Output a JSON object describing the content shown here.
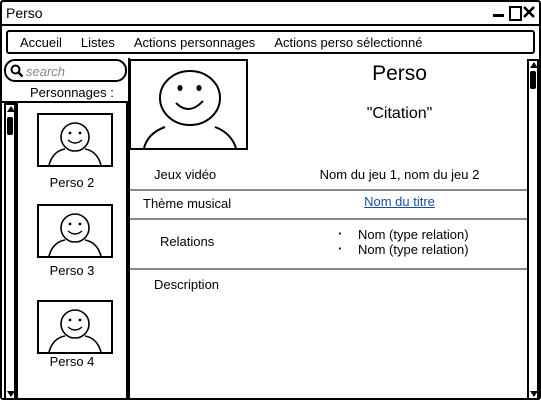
{
  "window": {
    "title": "Perso"
  },
  "menu": {
    "items": [
      {
        "label": "Accueil"
      },
      {
        "label": "Listes"
      },
      {
        "label": "Actions personnages"
      },
      {
        "label": "Actions perso sélectionné"
      }
    ]
  },
  "search": {
    "placeholder": "search",
    "value": ""
  },
  "sidebar": {
    "heading": "Personnages :",
    "characters": [
      {
        "label": "Perso 2"
      },
      {
        "label": "Perso 3"
      },
      {
        "label": "Perso 4"
      }
    ]
  },
  "main": {
    "name": "Perso",
    "quote": "\"Citation\"",
    "games_label": "Jeux vidéo",
    "games_value": "Nom du jeu 1, nom du jeu 2",
    "theme_label": "Thème musical",
    "theme_value": "Nom du titre",
    "relations_label": "Relations",
    "relations": [
      {
        "text": "Nom (type relation)"
      },
      {
        "text": "Nom (type relation)"
      }
    ],
    "description_label": "Description"
  },
  "colors": {
    "link": "#1b4f9c",
    "separator": "#888888"
  }
}
